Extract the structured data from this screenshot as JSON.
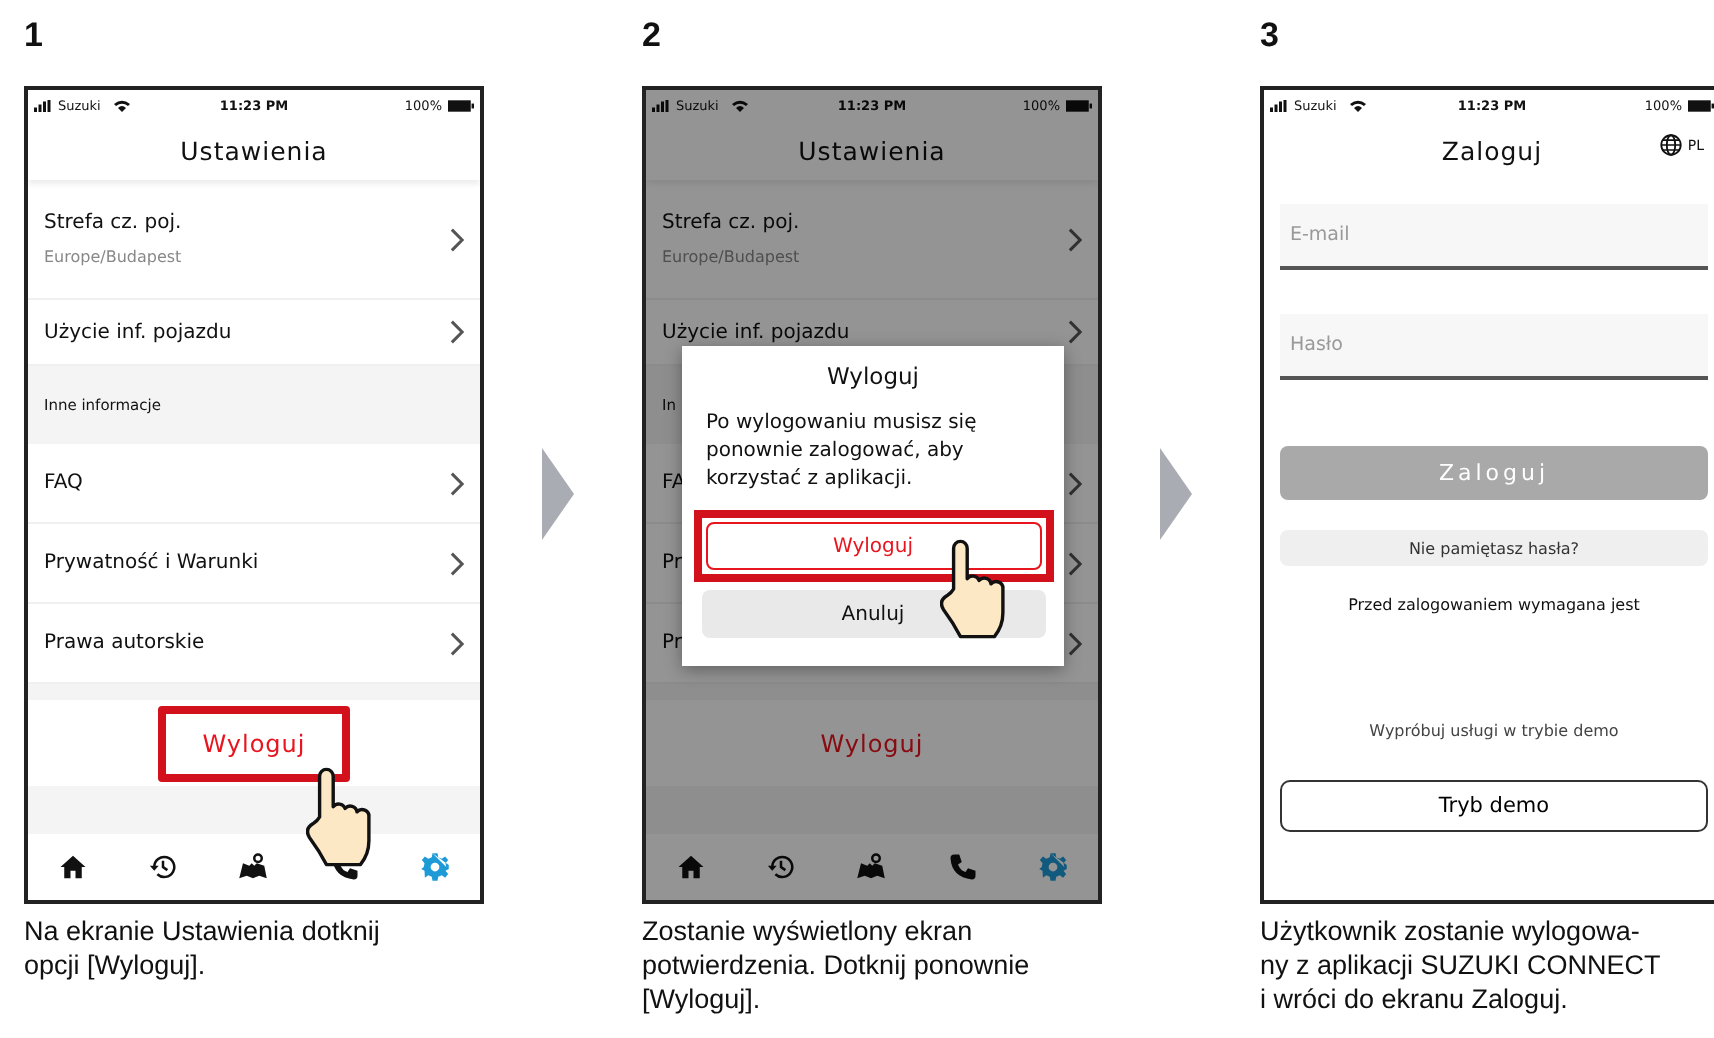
{
  "steps": [
    {
      "number": "1",
      "caption_lines": [
        "Na ekranie Ustawienia dotknij",
        "opcji [Wyloguj]."
      ],
      "screen": {
        "kind": "settings",
        "status": {
          "carrier": "Suzuki",
          "time": "11:23 PM",
          "battery": "100%"
        },
        "title": "Ustawienia",
        "rows": [
          {
            "kind": "item",
            "label": "Strefa cz. poj.",
            "sublabel": "Europe/Budapest"
          },
          {
            "kind": "item",
            "label": "Użycie inf. pojazdu"
          },
          {
            "kind": "section",
            "label": "Inne informacje"
          },
          {
            "kind": "item",
            "label": "FAQ"
          },
          {
            "kind": "item",
            "label": "Prywatność i Warunki"
          },
          {
            "kind": "item",
            "label": "Prawa autorskie"
          }
        ],
        "logout": {
          "label": "Wyloguj",
          "highlighted": true
        },
        "tabs": [
          {
            "kind": "home",
            "selected": false
          },
          {
            "kind": "history",
            "selected": false
          },
          {
            "kind": "map",
            "selected": false
          },
          {
            "kind": "phone",
            "selected": false
          },
          {
            "kind": "settings",
            "selected": true
          }
        ]
      }
    },
    {
      "number": "2",
      "caption_lines": [
        "Zostanie wyświetlony ekran",
        "potwierdzenia. Dotknij ponownie",
        "[Wyloguj]."
      ],
      "screen": {
        "kind": "settings",
        "status": {
          "carrier": "Suzuki",
          "time": "11:23 PM",
          "battery": "100%"
        },
        "title": "Ustawienia",
        "rows": [
          {
            "kind": "item",
            "label": "Strefa cz. poj.",
            "sublabel": "Europe/Budapest"
          },
          {
            "kind": "item",
            "label": "Użycie inf. pojazdu"
          },
          {
            "kind": "section",
            "label": "In"
          },
          {
            "kind": "item",
            "label": "FA"
          },
          {
            "kind": "item",
            "label": "Pr"
          },
          {
            "kind": "item",
            "label": "Pr"
          }
        ],
        "logout": {
          "label": "Wyloguj",
          "highlighted": false
        },
        "tabs": [
          {
            "kind": "home",
            "selected": false
          },
          {
            "kind": "history",
            "selected": false
          },
          {
            "kind": "map",
            "selected": false
          },
          {
            "kind": "phone",
            "selected": false
          },
          {
            "kind": "settings",
            "selected": true
          }
        ],
        "dialog": {
          "title": "Wyloguj",
          "message": "Po wylogowaniu musisz się ponownie zalogować, aby korzystać z aplikacji.",
          "buttons": [
            {
              "kind": "primary",
              "label": "Wyloguj",
              "highlighted": true
            },
            {
              "kind": "secondary",
              "label": "Anuluj",
              "highlighted": false
            }
          ]
        }
      }
    },
    {
      "number": "3",
      "caption_lines": [
        "Użytkownik zostanie wylogowa-",
        "ny z aplikacji SUZUKI CONNECT",
        "i wróci do ekranu Zaloguj."
      ],
      "screen": {
        "kind": "login",
        "status": {
          "carrier": "Suzuki",
          "time": "11:23 PM",
          "battery": "100%"
        },
        "title": "Zaloguj",
        "language": "PL",
        "fields": [
          {
            "placeholder": "E-mail"
          },
          {
            "placeholder": "Hasło"
          }
        ],
        "login_button": {
          "label": "Zaloguj",
          "disabled": true
        },
        "forgot": "Nie pamiętasz hasła?",
        "notice": "Przed zalogowaniem wymagana jest",
        "demo_text": "Wypróbuj usługi w trybie demo",
        "demo_button": "Tryb demo"
      }
    }
  ]
}
